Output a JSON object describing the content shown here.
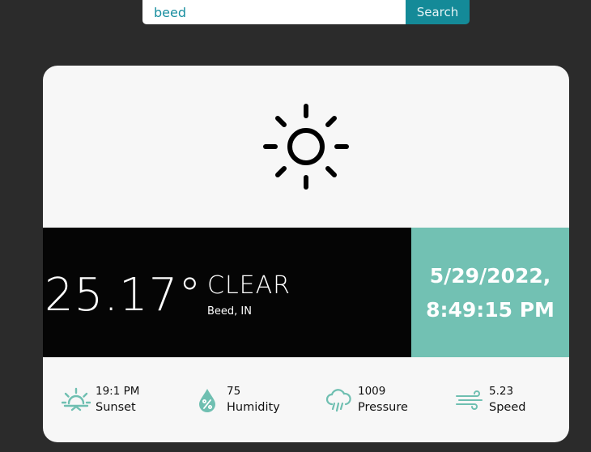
{
  "search": {
    "value": "beed",
    "button_label": "Search"
  },
  "weather": {
    "icon": "sun-icon",
    "temperature": "25.17°",
    "condition": "CLEAR",
    "location": "Beed, IN",
    "date": "5/29/2022,",
    "time": "8:49:15 PM"
  },
  "stats": [
    {
      "icon": "sunset-icon",
      "value": "19:1 PM",
      "label": "Sunset"
    },
    {
      "icon": "humidity-icon",
      "value": "75",
      "label": "Humidity"
    },
    {
      "icon": "pressure-icon",
      "value": "1009",
      "label": "Pressure"
    },
    {
      "icon": "wind-icon",
      "value": "5.23",
      "label": "Speed"
    }
  ],
  "colors": {
    "page_background": "#2b2b2b",
    "card_background": "#f7f7f7",
    "accent_teal": "#72c1b3",
    "search_button": "#148a98",
    "main_panel": "#050505"
  }
}
